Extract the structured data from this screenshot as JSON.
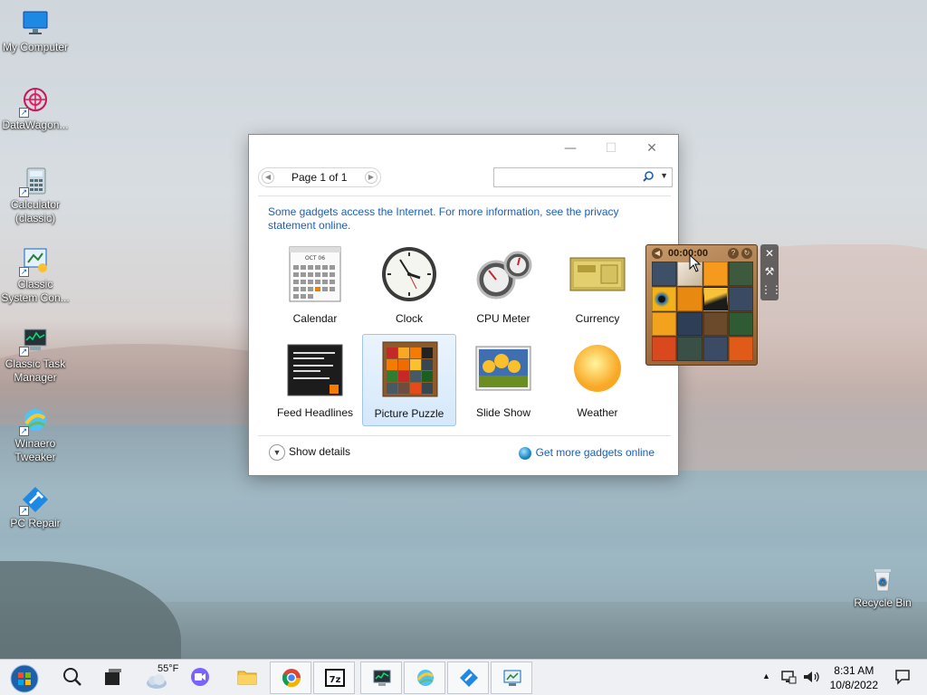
{
  "desktop": {
    "icons": [
      {
        "label": "My Computer",
        "icon": "monitor-icon"
      },
      {
        "label": "DataWagon...",
        "icon": "datawagon-icon"
      },
      {
        "label": "Calculator (classic)",
        "icon": "calculator-icon"
      },
      {
        "label": "Classic System Con...",
        "icon": "control-panel-icon"
      },
      {
        "label": "Classic Task Manager",
        "icon": "task-manager-icon"
      },
      {
        "label": "Winaero Tweaker",
        "icon": "winaero-icon"
      },
      {
        "label": "PC Repair",
        "icon": "pc-repair-icon"
      },
      {
        "label": "Recycle Bin",
        "icon": "recycle-bin-icon"
      }
    ]
  },
  "window": {
    "minimize": "—",
    "maximize": "☐",
    "close": "✕",
    "pager": {
      "text": "Page 1 of 1",
      "prev": "◀",
      "next": "▶"
    },
    "search": {
      "value": "",
      "placeholder": ""
    },
    "notice": "Some gadgets access the Internet.  For more information, see the privacy statement online.",
    "gadgets": [
      {
        "label": "Calendar",
        "icon": "calendar-icon"
      },
      {
        "label": "Clock",
        "icon": "clock-icon"
      },
      {
        "label": "CPU Meter",
        "icon": "cpu-meter-icon"
      },
      {
        "label": "Currency",
        "icon": "currency-icon"
      },
      {
        "label": "Feed Headlines",
        "icon": "feed-headlines-icon"
      },
      {
        "label": "Picture Puzzle",
        "icon": "picture-puzzle-icon"
      },
      {
        "label": "Slide Show",
        "icon": "slide-show-icon"
      },
      {
        "label": "Weather",
        "icon": "weather-icon"
      }
    ],
    "selected_gadget": "Picture Puzzle",
    "show_details": "Show details",
    "get_more": "Get more gadgets online"
  },
  "puzzle_gadget": {
    "timer": "00:00:00",
    "tools": [
      "✕",
      "🔧",
      "⠿"
    ]
  },
  "taskbar": {
    "weather_temp": "55°F",
    "clock_time": "8:31 AM",
    "clock_date": "10/8/2022",
    "apps": [
      "start-button",
      "search-icon",
      "task-view-icon",
      "weather-widget",
      "meet-icon",
      "file-explorer-icon",
      "chrome-icon",
      "7zip-icon",
      "task-manager-icon",
      "winaero-icon",
      "pc-repair-icon",
      "control-panel-icon"
    ]
  },
  "colors": {
    "accent": "#1b5fb5",
    "selection": "#d5e8fa"
  }
}
